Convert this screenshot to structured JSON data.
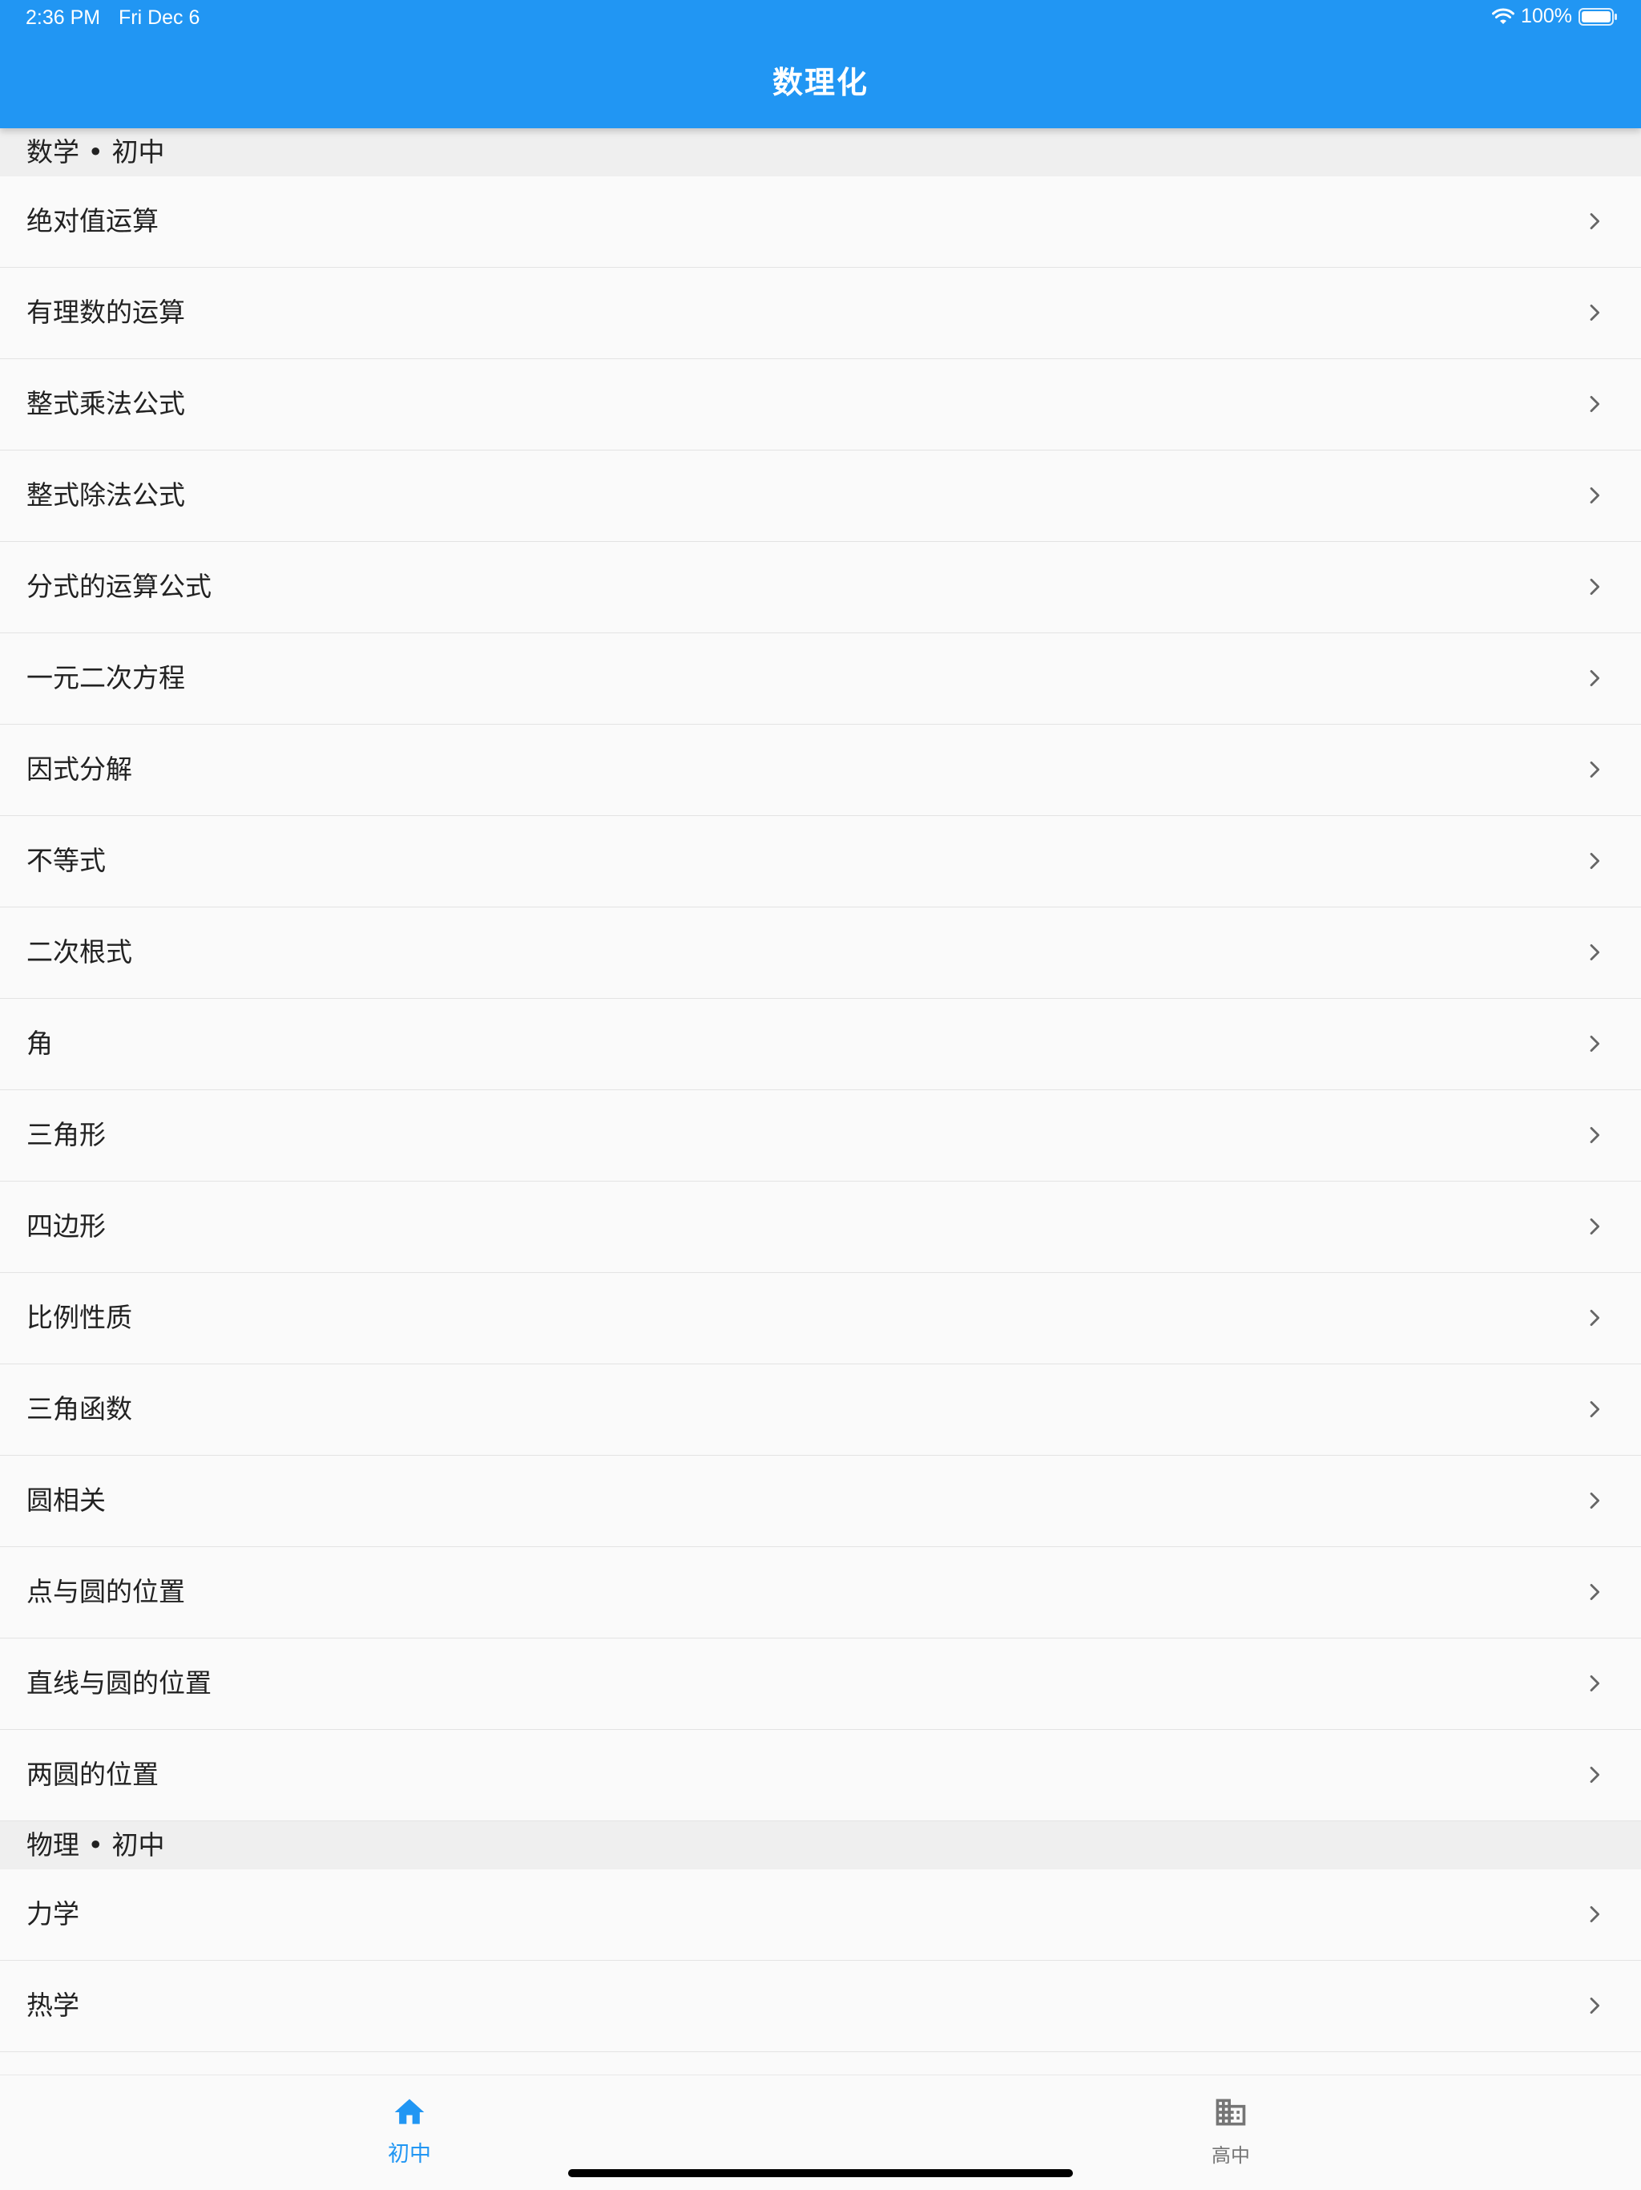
{
  "status_bar": {
    "time": "2:36 PM",
    "date": "Fri Dec 6",
    "battery": "100%"
  },
  "appbar": {
    "title": "数理化"
  },
  "sections": [
    {
      "header": "数学 • 初中",
      "items": [
        "绝对值运算",
        "有理数的运算",
        "整式乘法公式",
        "整式除法公式",
        "分式的运算公式",
        "一元二次方程",
        "因式分解",
        "不等式",
        "二次根式",
        "角",
        "三角形",
        "四边形",
        "比例性质",
        "三角函数",
        "圆相关",
        "点与圆的位置",
        "直线与圆的位置",
        "两圆的位置"
      ]
    },
    {
      "header": "物理 • 初中",
      "items": [
        "力学",
        "热学"
      ]
    }
  ],
  "bottom_nav": {
    "tabs": [
      {
        "label": "初中",
        "icon": "home-icon",
        "active": true
      },
      {
        "label": "高中",
        "icon": "building-icon",
        "active": false
      }
    ]
  },
  "colors": {
    "primary": "#2196f3",
    "inactive": "#757575",
    "section_bg": "#efefef",
    "list_bg": "#fafafa"
  }
}
